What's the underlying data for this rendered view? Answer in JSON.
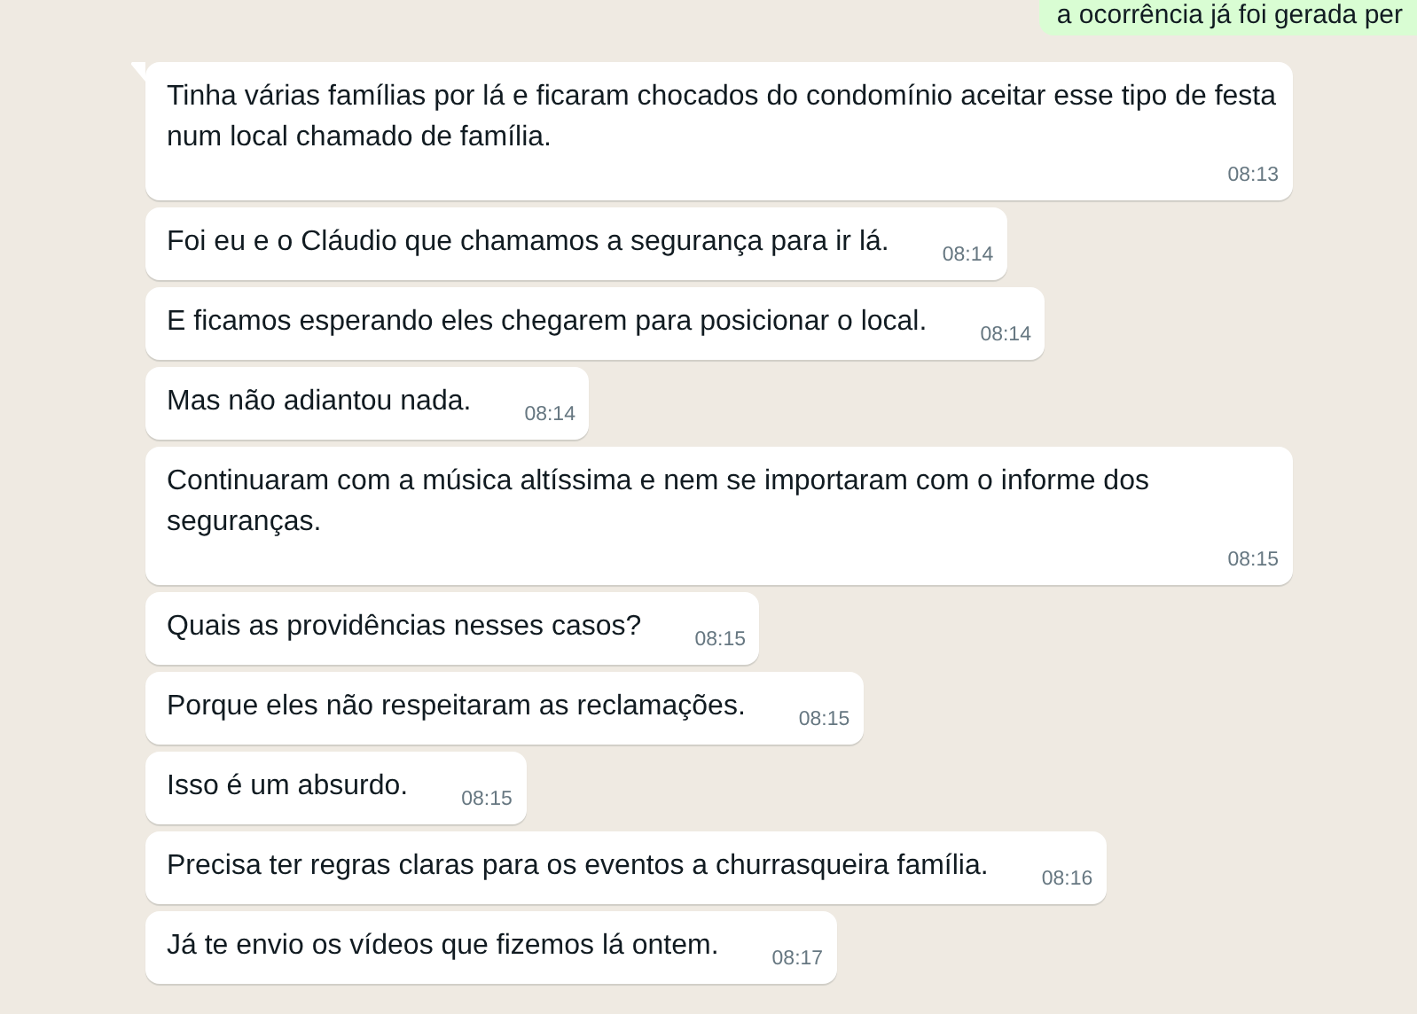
{
  "outgoing_message": {
    "text": "a ocorrência já foi gerada per"
  },
  "messages": [
    {
      "text": "Tinha várias famílias por lá e ficaram chocados do condomínio aceitar esse tipo de festa num local chamado de família.",
      "time": "08:13"
    },
    {
      "text": "Foi eu e o Cláudio que chamamos a segurança para ir lá.",
      "time": "08:14"
    },
    {
      "text": "E ficamos esperando eles chegarem para posicionar o local.",
      "time": "08:14"
    },
    {
      "text": "Mas não adiantou nada.",
      "time": "08:14"
    },
    {
      "text": "Continuaram com a música altíssima e nem se importaram com o informe dos seguranças.",
      "time": "08:15"
    },
    {
      "text": "Quais as providências nesses casos?",
      "time": "08:15"
    },
    {
      "text": "Porque eles não respeitaram as reclamações.",
      "time": "08:15"
    },
    {
      "text": "Isso é um absurdo.",
      "time": "08:15"
    },
    {
      "text": "Precisa ter regras claras para os eventos a churrasqueira família.",
      "time": "08:16"
    },
    {
      "text": "Já te envio os vídeos que fizemos lá ontem.",
      "time": "08:17"
    }
  ]
}
